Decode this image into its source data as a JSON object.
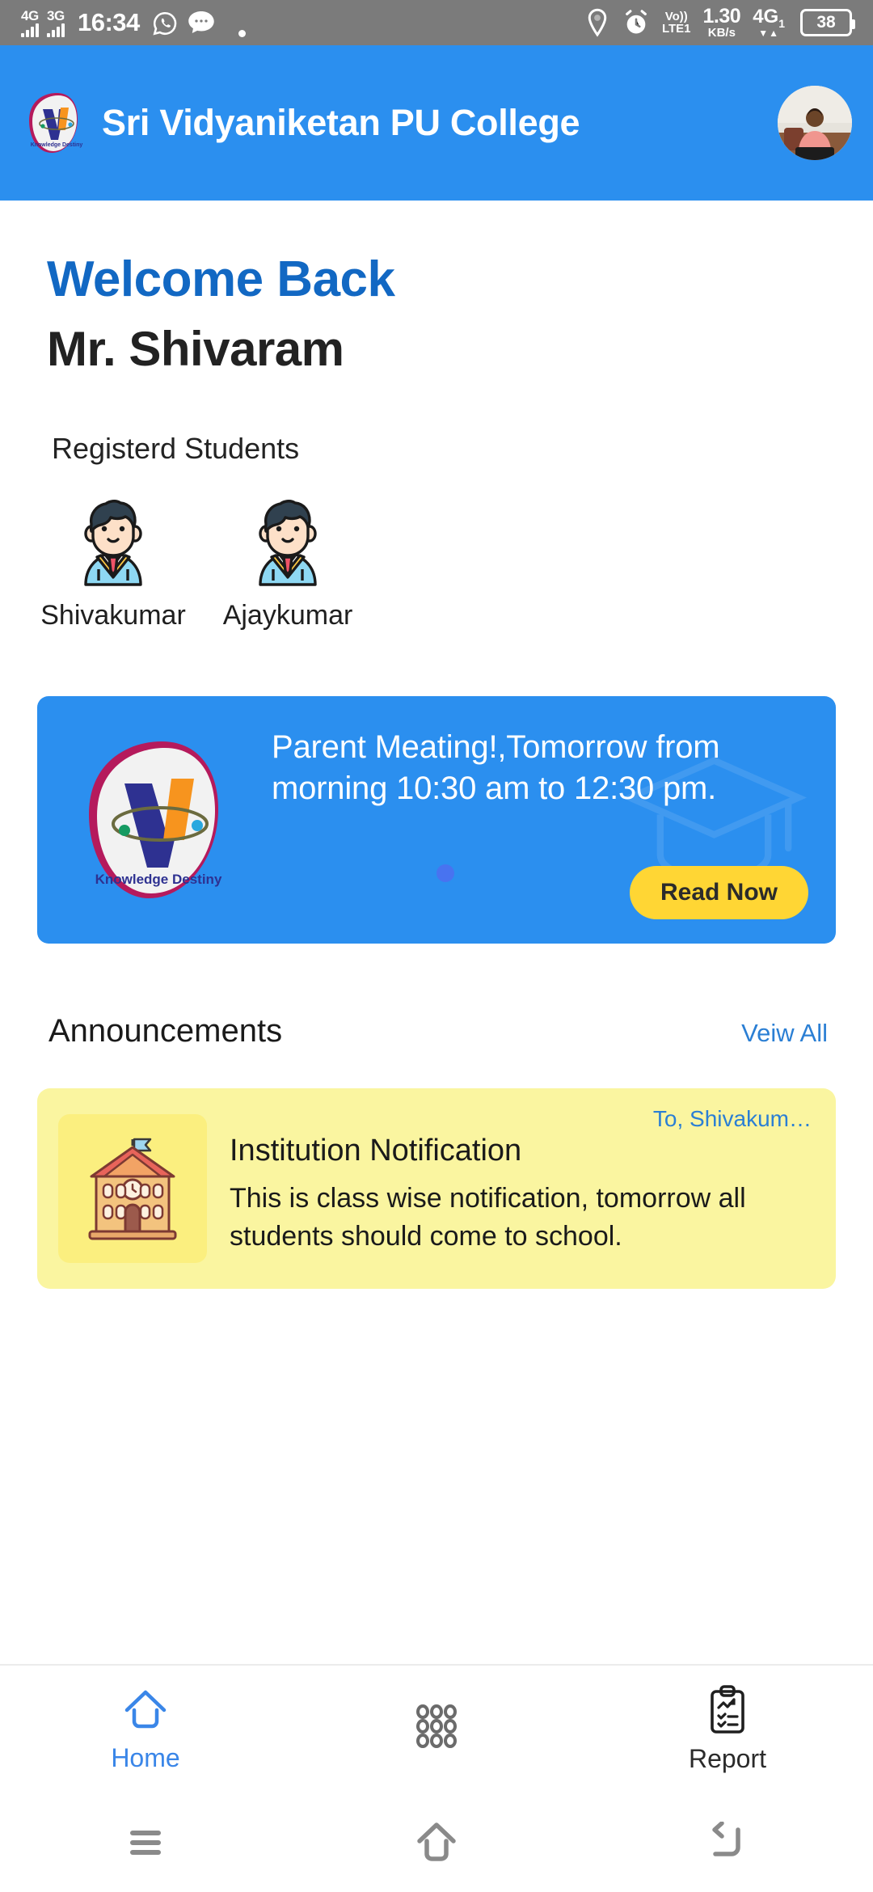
{
  "status_bar": {
    "sim1_network": "4G",
    "sim2_network": "3G",
    "time": "16:34",
    "whatsapp_icon": "whatsapp-icon",
    "messages_icon": "messages-icon",
    "location_icon": "location-icon",
    "alarm_icon": "alarm-icon",
    "volte_top": "Vo))",
    "volte_bottom": "LTE1",
    "net_speed_value": "1.30",
    "net_speed_unit": "KB/s",
    "data_network": "4G",
    "data_network_sub": "1",
    "data_arrows": "▼▲",
    "battery_level": "38"
  },
  "app_bar": {
    "logo_icon": "college-logo-icon",
    "title": "Sri Vidyaniketan PU College",
    "avatar_icon": "user-avatar"
  },
  "main": {
    "welcome_greeting": "Welcome Back",
    "user_name": "Mr. Shivaram",
    "students_section_label": "Registerd Students",
    "students": [
      {
        "name": "Shivakumar",
        "icon": "student-avatar-icon"
      },
      {
        "name": "Ajaykumar",
        "icon": "student-avatar-icon"
      }
    ],
    "banner": {
      "logo_icon": "college-logo-icon",
      "logo_caption": "Knowledge Destiny",
      "message": "Parent Meating!,Tomorrow from morning 10:30 am to 12:30 pm.",
      "cta_label": "Read Now",
      "watermark_icon": "graduation-cap-watermark"
    },
    "announcements": {
      "title": "Announcements",
      "view_all_label": "Veiw All",
      "items": [
        {
          "icon": "school-building-icon",
          "recipient": "To, Shivakum…",
          "heading": "Institution Notification",
          "body": "This is class wise notification, tomorrow all students should come to school."
        }
      ]
    }
  },
  "bottom_nav": {
    "items": [
      {
        "label": "Home",
        "icon": "home-icon",
        "active": true
      },
      {
        "label": "",
        "icon": "grid-dots-icon",
        "active": false
      },
      {
        "label": "Report",
        "icon": "clipboard-report-icon",
        "active": false
      }
    ]
  },
  "system_nav": {
    "recents_icon": "recents-menu-icon",
    "home_icon": "system-home-icon",
    "back_icon": "system-back-icon"
  },
  "colors": {
    "brand_blue": "#2b8fef",
    "welcome_blue": "#1268c3",
    "cta_yellow": "#ffd634",
    "notice_yellow": "#faf5a0",
    "link_blue": "#2b7fd4"
  }
}
